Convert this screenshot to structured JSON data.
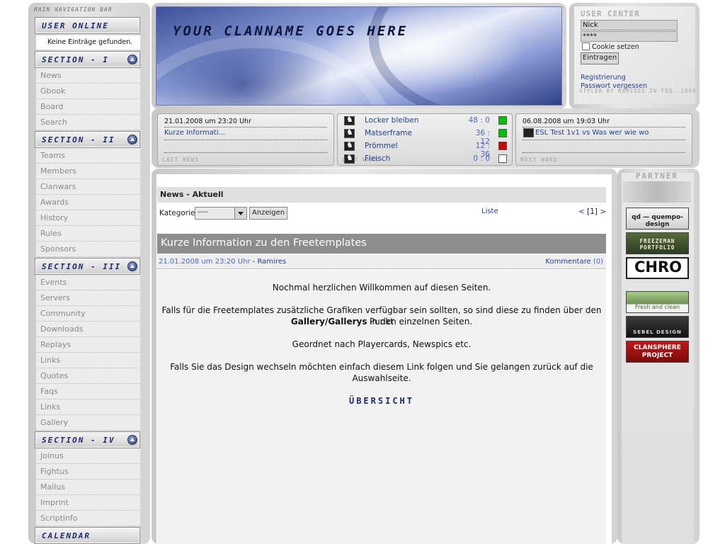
{
  "nav": {
    "title": "MAIN NAVIGATION BAR",
    "user_online_label": "USER ONLINE",
    "online_text": "Keine Einträge gefunden.",
    "sections": [
      {
        "label": "SECTION - I",
        "items": [
          "News",
          "Gbook",
          "Board",
          "Search"
        ]
      },
      {
        "label": "SECTION - II",
        "items": [
          "Teams",
          "Members",
          "Clanwars",
          "Awards",
          "History",
          "Rules",
          "Sponsors"
        ]
      },
      {
        "label": "SECTION - III",
        "items": [
          "Events",
          "Servers",
          "Community",
          "Downloads",
          "Replays",
          "Links",
          "Quotes",
          "Faqs",
          "Links",
          "Gallery"
        ]
      },
      {
        "label": "SECTION - IV",
        "items": [
          "Joinus",
          "Fightus",
          "Mailus",
          "Imprint",
          "Scriptinfo"
        ]
      }
    ],
    "calendar_label": "CALENDAR"
  },
  "header": {
    "clanname": "YOUR CLANNAME GOES HERE"
  },
  "user_center": {
    "title": "USER CENTER",
    "nick_value": "Nick",
    "password_value": "****",
    "cookie_label": "Cookie setzen",
    "cookie_checked": false,
    "submit_label": "Eintragen",
    "register_link": "Registrierung",
    "forgot_link": "Passwort vergessen",
    "styled_by": "STYLED BY RAMIRES IN FEB. 2008"
  },
  "last_news": {
    "date": "21.01.2008 um 23:20 Uhr",
    "link": "Kurze Informati...",
    "label": "LAST NEWS"
  },
  "last_wars": {
    "label": "LAST WARS",
    "rows": [
      {
        "name": "Locker bleiben",
        "score": "48 : 0",
        "status_color": "#00c000"
      },
      {
        "name": "Matserframe",
        "score": "36 : 12",
        "status_color": "#00c000"
      },
      {
        "name": "Prömmel",
        "score": "12 : 36",
        "status_color": "#cc0000"
      },
      {
        "name": "Fleisch",
        "score": "0 : 0",
        "status_color": "#ffffff"
      }
    ]
  },
  "next_wars": {
    "date": "06.08.2008 um 19:03 Uhr",
    "link": "ESL Test 1v1 vs Was wer wie wo",
    "label": "NEXT WARS"
  },
  "news": {
    "heading": "News - Aktuell",
    "category_label": "Kategorie",
    "category_value": "----",
    "show_button": "Anzeigen",
    "list_link": "Liste",
    "pager_prev": "<",
    "pager_current": "[1]",
    "pager_next": ">",
    "article": {
      "title": "Kurze Information zu den Freetemplates",
      "date": "21.01.2008 um 23:20 Uhr",
      "separator": " - ",
      "author": "Ramires",
      "comments_label": "Kommentare",
      "comments_count": "(0)",
      "p1": "Nochmal herzlichen Willkommen auf diesen Seiten.",
      "p2a": "Falls für die Freetemplates zusätzliche Grafiken verfügbar sein sollten, so sind diese zu finden über den Punkt",
      "p2b_strong": "Gallery/Gallerys",
      "p2b_rest": " in den einzelnen Seiten.",
      "p3": "Geordnet nach Playercards, Newspics etc.",
      "p4a": "Falls Sie das Design wechseln möchten einfach diesem Link folgen und Sie gelangen zurück auf die",
      "p4b": "Auswahlseite.",
      "link": "ÜBERSICHT"
    }
  },
  "partner": {
    "title": "PARTNER",
    "banners": [
      {
        "text": "qd — quempo-design"
      },
      {
        "text": "FREEZEMAN PORTFOLIO"
      },
      {
        "text": "CHRO"
      },
      {
        "text": "Fresh and clean"
      },
      {
        "text": "SEBEL DESIGN"
      },
      {
        "text": "CLANSPHERE PROJECT"
      }
    ]
  }
}
